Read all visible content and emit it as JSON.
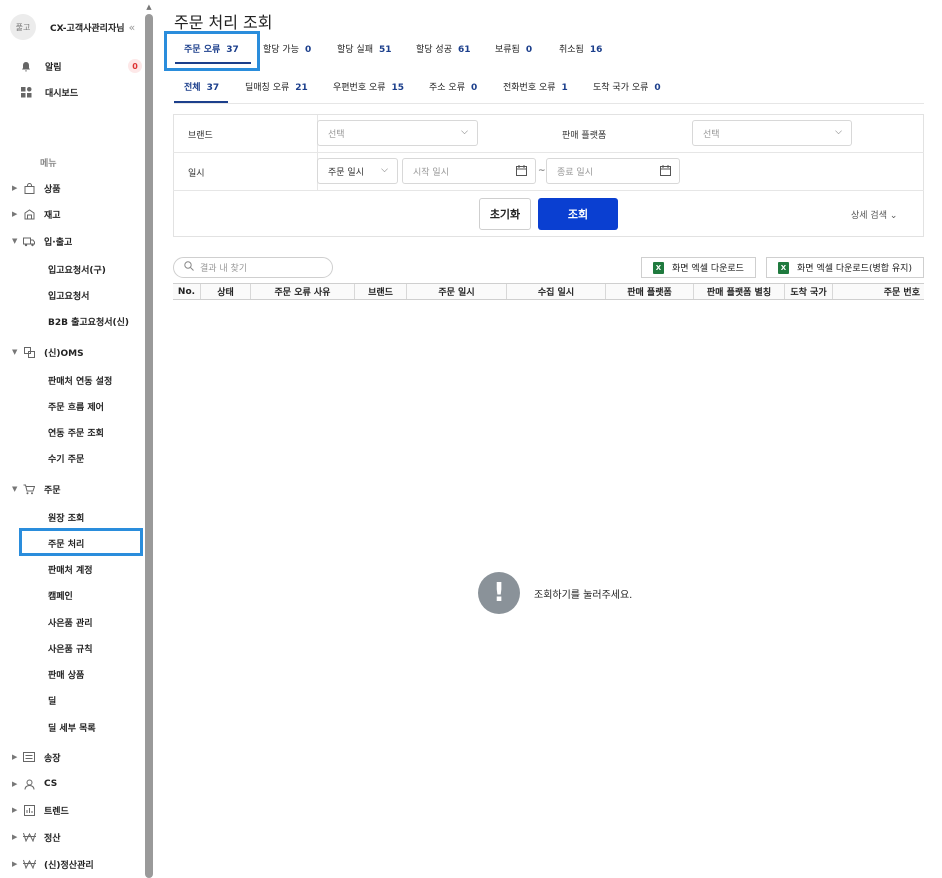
{
  "sidebar": {
    "avatar": "풀고",
    "company": "CX-고객사관리자님",
    "collapse": "«",
    "alert": {
      "label": "알림",
      "count": "0"
    },
    "dashboard": "대시보드",
    "menu_title": "메뉴",
    "sections": {
      "product": "상품",
      "stock": "재고",
      "inout": "입·출고",
      "inout_items": [
        "입고요청서(구)",
        "입고요청서",
        "B2B 출고요청서(신)"
      ],
      "oms": "(신)OMS",
      "oms_items": [
        "판매처 연동 설정",
        "주문 흐름 제어",
        "연동 주문 조회",
        "수기 주문"
      ],
      "order": "주문",
      "order_items": [
        "원장 조회",
        "주문 처리",
        "판매처 계정",
        "캠페인",
        "사은품 관리",
        "사은품 규칙",
        "판매 상품",
        "딜",
        "딜 세부 목록"
      ],
      "invoice": "송장",
      "cs": "CS",
      "trend": "트렌드",
      "settle": "정산",
      "settle_new": "(신)정산관리"
    }
  },
  "page": {
    "title": "주문 처리 조회"
  },
  "tabs_main": [
    {
      "label": "주문 오류",
      "count": "37"
    },
    {
      "label": "할당 가능",
      "count": "0"
    },
    {
      "label": "할당 실패",
      "count": "51"
    },
    {
      "label": "할당 성공",
      "count": "61"
    },
    {
      "label": "보류됨",
      "count": "0"
    },
    {
      "label": "취소됨",
      "count": "16"
    }
  ],
  "tabs_sub": [
    {
      "label": "전체",
      "count": "37"
    },
    {
      "label": "딜매칭 오류",
      "count": "21"
    },
    {
      "label": "우편번호 오류",
      "count": "15"
    },
    {
      "label": "주소 오류",
      "count": "0"
    },
    {
      "label": "전화번호 오류",
      "count": "1"
    },
    {
      "label": "도착 국가 오류",
      "count": "0"
    }
  ],
  "filter": {
    "brand_label": "브랜드",
    "brand_placeholder": "선택",
    "platform_label": "판매 플랫폼",
    "platform_placeholder": "선택",
    "date_label": "일시",
    "date_type": "주문 일시",
    "start_placeholder": "시작 일시",
    "end_placeholder": "종료 일시",
    "tilde": "~",
    "reset": "초기화",
    "search": "조회",
    "detail": "상세 검색 ⌄"
  },
  "toolbar": {
    "search_placeholder": "결과 내 찾기",
    "excel_download": "화면 엑셀 다운로드",
    "excel_download_merge": "화면 엑셀 다운로드(병합 유지)"
  },
  "table": {
    "columns": [
      "No.",
      "상태",
      "주문 오류 사유",
      "브랜드",
      "주문 일시",
      "수집 일시",
      "판매 플랫폼",
      "판매 플랫폼 별칭",
      "도착 국가",
      "주문 번호"
    ]
  },
  "empty": {
    "icon": "!",
    "message": "조회하기를 눌러주세요."
  }
}
